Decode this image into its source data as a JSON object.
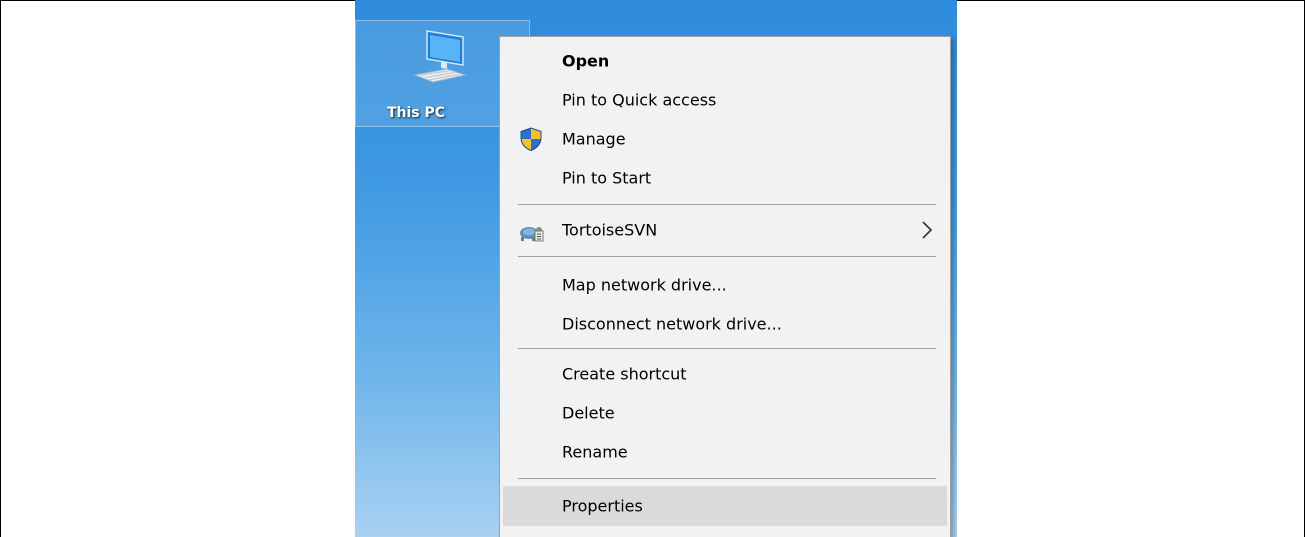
{
  "desktop": {
    "icon_label": "This PC",
    "icon_name": "computer-monitor-icon"
  },
  "context_menu": {
    "items": [
      {
        "label": "Open",
        "bold": true
      },
      {
        "label": "Pin to Quick access"
      },
      {
        "label": "Manage",
        "icon": "uac-shield-icon"
      },
      {
        "label": "Pin to Start"
      },
      {
        "label": "TortoiseSVN",
        "icon": "tortoisesvn-icon",
        "submenu": true
      },
      {
        "label": "Map network drive..."
      },
      {
        "label": "Disconnect network drive..."
      },
      {
        "label": "Create shortcut"
      },
      {
        "label": "Delete"
      },
      {
        "label": "Rename"
      },
      {
        "label": "Properties",
        "highlighted": true
      }
    ]
  },
  "colors": {
    "menu_background": "#f2f2f2",
    "menu_highlight": "#dadada",
    "menu_border": "#a0a0a0",
    "desktop_blue": "#2e8bdb",
    "shield_blue": "#2f6fc7",
    "shield_yellow": "#f2c12e"
  }
}
